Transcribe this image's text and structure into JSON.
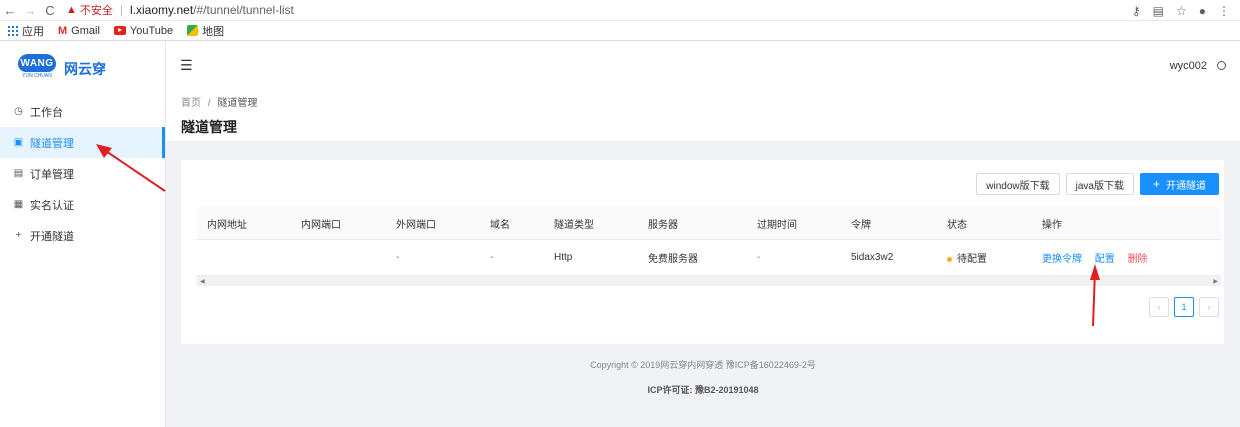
{
  "browser": {
    "back": "←",
    "forward": "→",
    "reload": "C",
    "security_label": "不安全",
    "url_host": "l.xiaomy.net",
    "url_path": "/#/tunnel/tunnel-list",
    "bookmarks": [
      {
        "label": "应用",
        "icon": "apps-grid-icon"
      },
      {
        "label": "Gmail",
        "icon": "gmail-icon"
      },
      {
        "label": "YouTube",
        "icon": "youtube-icon"
      },
      {
        "label": "地图",
        "icon": "maps-icon"
      }
    ]
  },
  "logo": {
    "badge": "WANG",
    "sub": "YUN CHUAN",
    "title": "网云穿"
  },
  "sidebar": {
    "items": [
      {
        "label": "工作台",
        "icon": "clock-icon",
        "glyph": "◷"
      },
      {
        "label": "隧道管理",
        "icon": "tunnel-icon",
        "glyph": "▣",
        "active": true
      },
      {
        "label": "订单管理",
        "icon": "order-icon",
        "glyph": "▤"
      },
      {
        "label": "实名认证",
        "icon": "id-card-icon",
        "glyph": "▦"
      },
      {
        "label": "开通隧道",
        "icon": "plus-icon",
        "glyph": "+"
      }
    ]
  },
  "topbar": {
    "fold_glyph": "☰",
    "username": "wyc002"
  },
  "breadcrumb": {
    "home": "首页",
    "sep": "/",
    "current": "隧道管理"
  },
  "page_title": "隧道管理",
  "toolbar": {
    "window_download": "window版下载",
    "java_download": "java版下载",
    "open_tunnel": "开通隧道",
    "open_tunnel_glyph": "+"
  },
  "table": {
    "columns": [
      "内网地址",
      "内网端口",
      "外网端口",
      "域名",
      "隧道类型",
      "服务器",
      "过期时间",
      "令牌",
      "状态",
      "操作"
    ],
    "rows": [
      {
        "internal_addr": "",
        "internal_port": "",
        "external_port": "-",
        "domain": "-",
        "type": "Http",
        "server": "免费服务器",
        "expire": "-",
        "token": "5idax3w2",
        "status": "待配置",
        "actions": {
          "change_token": "更换令牌",
          "configure": "配置",
          "delete": "删除"
        }
      }
    ]
  },
  "pagination": {
    "prev": "‹",
    "current": "1",
    "next": "›"
  },
  "footer": {
    "copyright": "Copyright © 2019网云穿内网穿透 豫ICP备16022469-2号",
    "license": "ICP许可证: 豫B2-20191048"
  },
  "colors": {
    "primary": "#1890ff",
    "danger": "#ff4d4f",
    "warning": "#faad14",
    "annotation": "#e02020"
  }
}
